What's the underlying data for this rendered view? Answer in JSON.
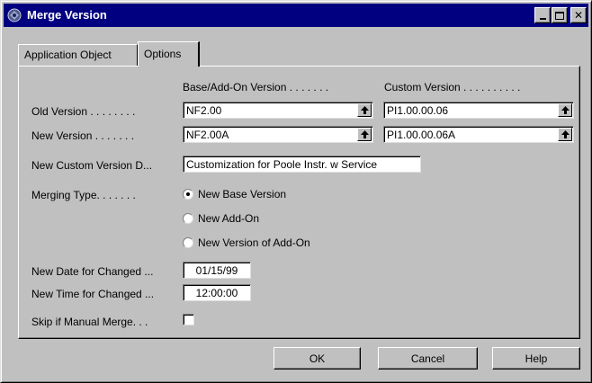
{
  "window": {
    "title": "Merge Version",
    "title_bar_color": "#000080",
    "controls": [
      "minimize-icon",
      "maximize-icon",
      "close-icon"
    ]
  },
  "tabs": [
    {
      "label": "Application Object",
      "selected": false
    },
    {
      "label": "Options",
      "selected": true
    }
  ],
  "columns": {
    "base": "Base/Add-On Version . . . . . . .",
    "custom": "Custom Version . . . . . . . . . ."
  },
  "rows": {
    "old_version": {
      "label": "Old Version . . . . . . . .",
      "base": "NF2.00",
      "custom": "PI1.00.00.06"
    },
    "new_version": {
      "label": "New Version . . . . . . .",
      "base": "NF2.00A",
      "custom": "PI1.00.00.06A"
    }
  },
  "custom_desc": {
    "label": "New Custom Version D...",
    "value": "Customization for Poole Instr. w Service"
  },
  "merging_type": {
    "label": "Merging Type. . . . . . .",
    "options": [
      {
        "label": "New Base Version",
        "checked": true
      },
      {
        "label": "New Add-On",
        "checked": false
      },
      {
        "label": "New Version of Add-On",
        "checked": false
      }
    ]
  },
  "date_changed": {
    "label": "New Date for Changed ...",
    "value": "01/15/99"
  },
  "time_changed": {
    "label": "New Time for Changed ...",
    "value": "12:00:00"
  },
  "skip_manual": {
    "label": "Skip if Manual Merge. . .",
    "checked": false
  },
  "buttons": {
    "ok": "OK",
    "cancel": "Cancel",
    "help": "Help"
  }
}
